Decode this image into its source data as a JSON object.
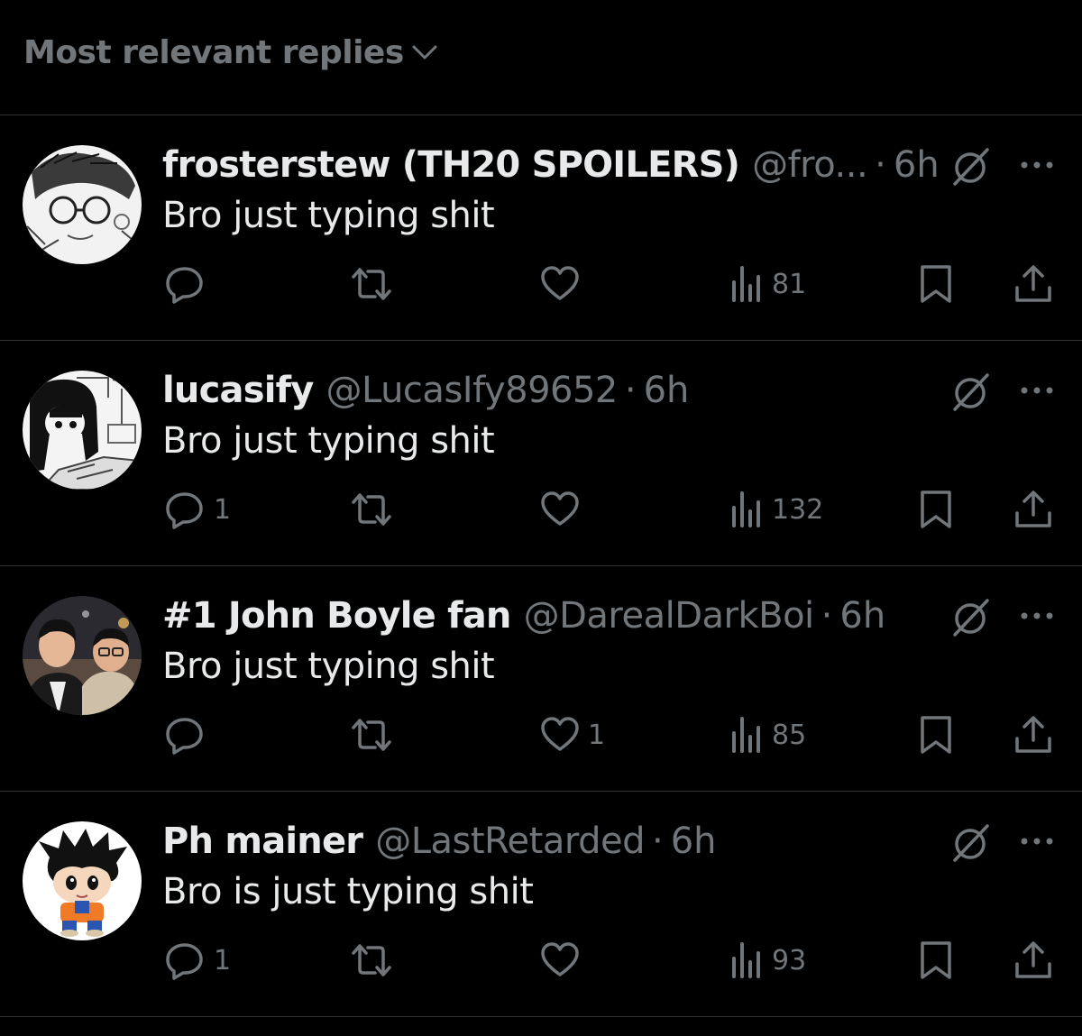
{
  "sort": {
    "label": "Most relevant replies",
    "icon": "chevron-down-icon"
  },
  "colors": {
    "background": "#000000",
    "primary_text": "#e7e9ea",
    "secondary_text": "#71767b",
    "divider": "#2f3336"
  },
  "replies": [
    {
      "display_name": "frosterstew (TH20 SPOILERS)",
      "handle": "@fro...",
      "dot": "·",
      "time": "6h",
      "text": "Bro just typing shit",
      "reply_count": "",
      "like_count": "",
      "views": "81",
      "avatar": "sketch-character-avatar"
    },
    {
      "display_name": "lucasify",
      "handle": "@LucasIfy89652",
      "dot": "·",
      "time": "6h",
      "text": "Bro just typing shit",
      "reply_count": "1",
      "like_count": "",
      "views": "132",
      "avatar": "manga-girl-avatar"
    },
    {
      "display_name": "#1 John Boyle fan",
      "handle": "@DarealDarkBoi",
      "dot": "·",
      "time": "6h",
      "text": "Bro just typing shit",
      "reply_count": "",
      "like_count": "1",
      "views": "85",
      "avatar": "photo-two-people-avatar"
    },
    {
      "display_name": "Ph mainer",
      "handle": "@LastRetarded",
      "dot": "·",
      "time": "6h",
      "text": "Bro is just typing shit",
      "reply_count": "1",
      "like_count": "",
      "views": "93",
      "avatar": "plush-toy-avatar"
    }
  ]
}
